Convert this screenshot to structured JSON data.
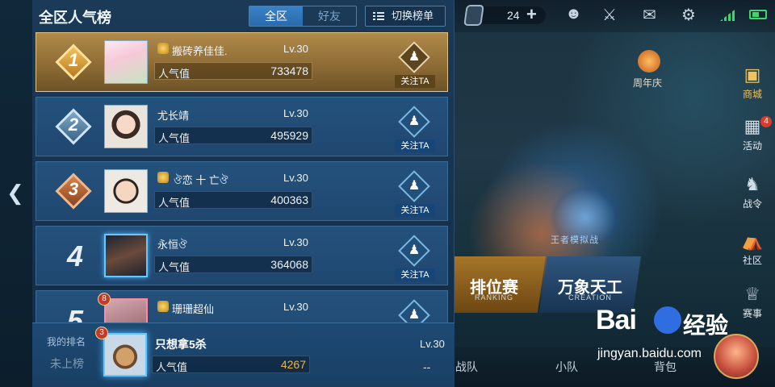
{
  "panel": {
    "title": "全区人气榜",
    "tabs": [
      {
        "label": "全区",
        "active": true
      },
      {
        "label": "好友",
        "active": false
      }
    ],
    "switch_label": "切换榜单",
    "pop_label": "人气值",
    "follow_label": "关注TA"
  },
  "rows": [
    {
      "rank": "1",
      "name": "搬砖养佳佳.",
      "level": "Lv.30",
      "popularity": "733478"
    },
    {
      "rank": "2",
      "name": "尤长靖",
      "level": "Lv.30",
      "popularity": "495929"
    },
    {
      "rank": "3",
      "name": "ঔ恋 十 亡ঔ",
      "level": "Lv.30",
      "popularity": "400363"
    },
    {
      "rank": "4",
      "name": "永恒ঔ",
      "level": "Lv.30",
      "popularity": "364068"
    },
    {
      "rank": "5",
      "name": "珊珊超仙",
      "level": "Lv.30",
      "popularity": "",
      "avatar_badge": "8"
    }
  ],
  "my_rank": {
    "label": "我的排名",
    "status": "未上榜",
    "badge": "3",
    "name": "只想拿5杀",
    "level": "Lv.30",
    "popularity_label": "人气值",
    "popularity": "4267",
    "rank_dash": "--"
  },
  "background": {
    "resource_count": "24",
    "anniversary_label": "周年庆",
    "side_menu": [
      {
        "label": "商城",
        "icon": "shop-icon",
        "active": true,
        "badge": ""
      },
      {
        "label": "活动",
        "icon": "gift-icon",
        "active": false,
        "badge": "4"
      },
      {
        "label": "战令",
        "icon": "horse-icon",
        "active": false,
        "badge": ""
      },
      {
        "label": "社区",
        "icon": "community-icon",
        "active": false,
        "badge": ""
      },
      {
        "label": "赛事",
        "icon": "trophy-icon",
        "active": false,
        "badge": ""
      }
    ],
    "mode_logo_label": "王者模拟战",
    "modes": [
      {
        "title": "排位赛",
        "sub": "RANKING"
      },
      {
        "title": "万象天工",
        "sub": "CREATION"
      }
    ],
    "bottom": [
      {
        "label": "战队"
      },
      {
        "label": "小队"
      },
      {
        "label": "背包"
      }
    ],
    "watermark": {
      "brand": "Bai",
      "brand2": "经验",
      "url": "jingyan.baidu.com"
    }
  },
  "colors": {
    "gold_row": "#b08a4a",
    "row": "#24527c",
    "panel": "#1b3a58",
    "popularity_self": "#f3b33a"
  }
}
